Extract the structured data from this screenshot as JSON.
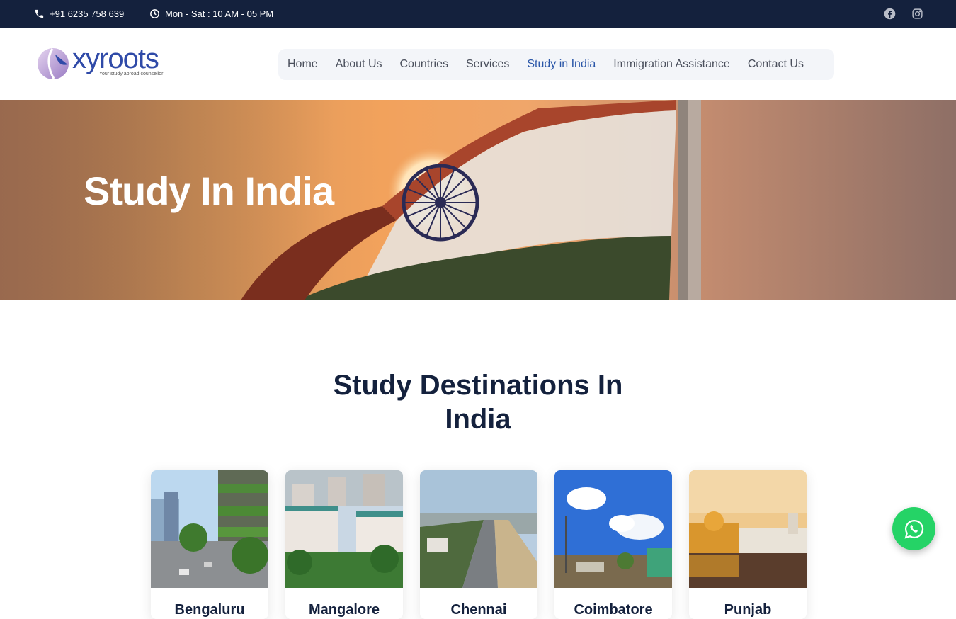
{
  "topbar": {
    "phone": "+91 6235 758 639",
    "hours": "Mon - Sat : 10 AM - 05 PM",
    "social": [
      "facebook-icon",
      "instagram-icon"
    ]
  },
  "brand": {
    "name": "xyroots",
    "tagline": "Your study abroad counsellor"
  },
  "nav": {
    "items": [
      "Home",
      "About Us",
      "Countries",
      "Services",
      "Study in India",
      "Immigration Assistance",
      "Contact Us"
    ],
    "active": "Study in India"
  },
  "hero": {
    "title": "Study In India"
  },
  "destinations": {
    "title_line1": "Study Destinations In",
    "title_line2": "India",
    "cards": [
      "Bengaluru",
      "Mangalore",
      "Chennai",
      "Coimbatore",
      "Punjab"
    ]
  },
  "colors": {
    "topbar": "#14213d",
    "heading": "#14213d",
    "nav_active": "#2a56a8",
    "whatsapp": "#25d366"
  }
}
